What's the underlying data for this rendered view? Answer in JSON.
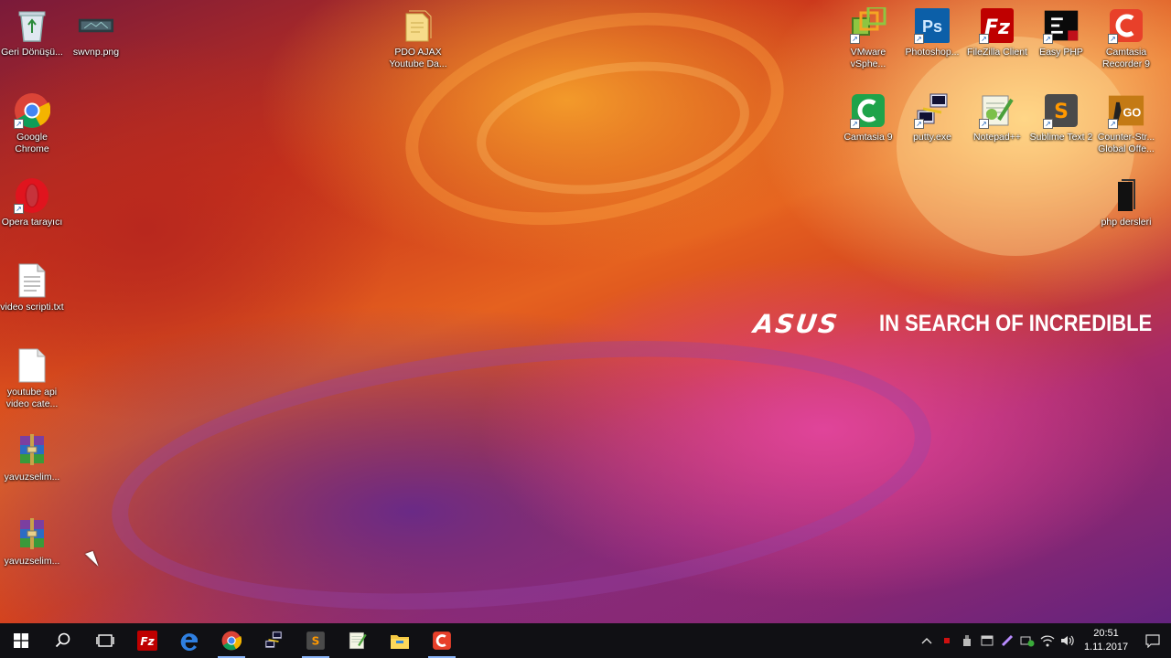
{
  "desktop": {
    "brand": {
      "logo_text": "ASUS",
      "slogan": "IN SEARCH OF INCREDIBLE"
    },
    "icons": {
      "recycle_bin": "Geri Dönüşü...",
      "swvnp": "swvnp.png",
      "pdo_ajax": "PDO AJAX Youtube Da...",
      "vmware": "VMware vSphe...",
      "photoshop": "Photoshop...",
      "filezilla": "FileZilla Client",
      "easyphp": "Easy PHP",
      "camtasia_recorder": "Camtasia Recorder 9",
      "chrome": "Google Chrome",
      "camtasia": "Camtasia 9",
      "putty": "putty.exe",
      "notepadpp": "Notepad++",
      "sublime": "Sublime Text 2",
      "csgo": "Counter-Str... Global Offe...",
      "opera": "Opera tarayıcı",
      "php_dersleri": "php dersleri",
      "video_scripti": "video scripti.txt",
      "youtube_api": "youtube api video cate...",
      "yavuzselim1": "yavuzselim...",
      "yavuzselim2": "yavuzselim..."
    }
  },
  "taskbar": {
    "clock_time": "20:51",
    "clock_date": "1.11.2017",
    "colors": {
      "background": "#101014",
      "active_indicator": "#8ab4f8"
    }
  }
}
